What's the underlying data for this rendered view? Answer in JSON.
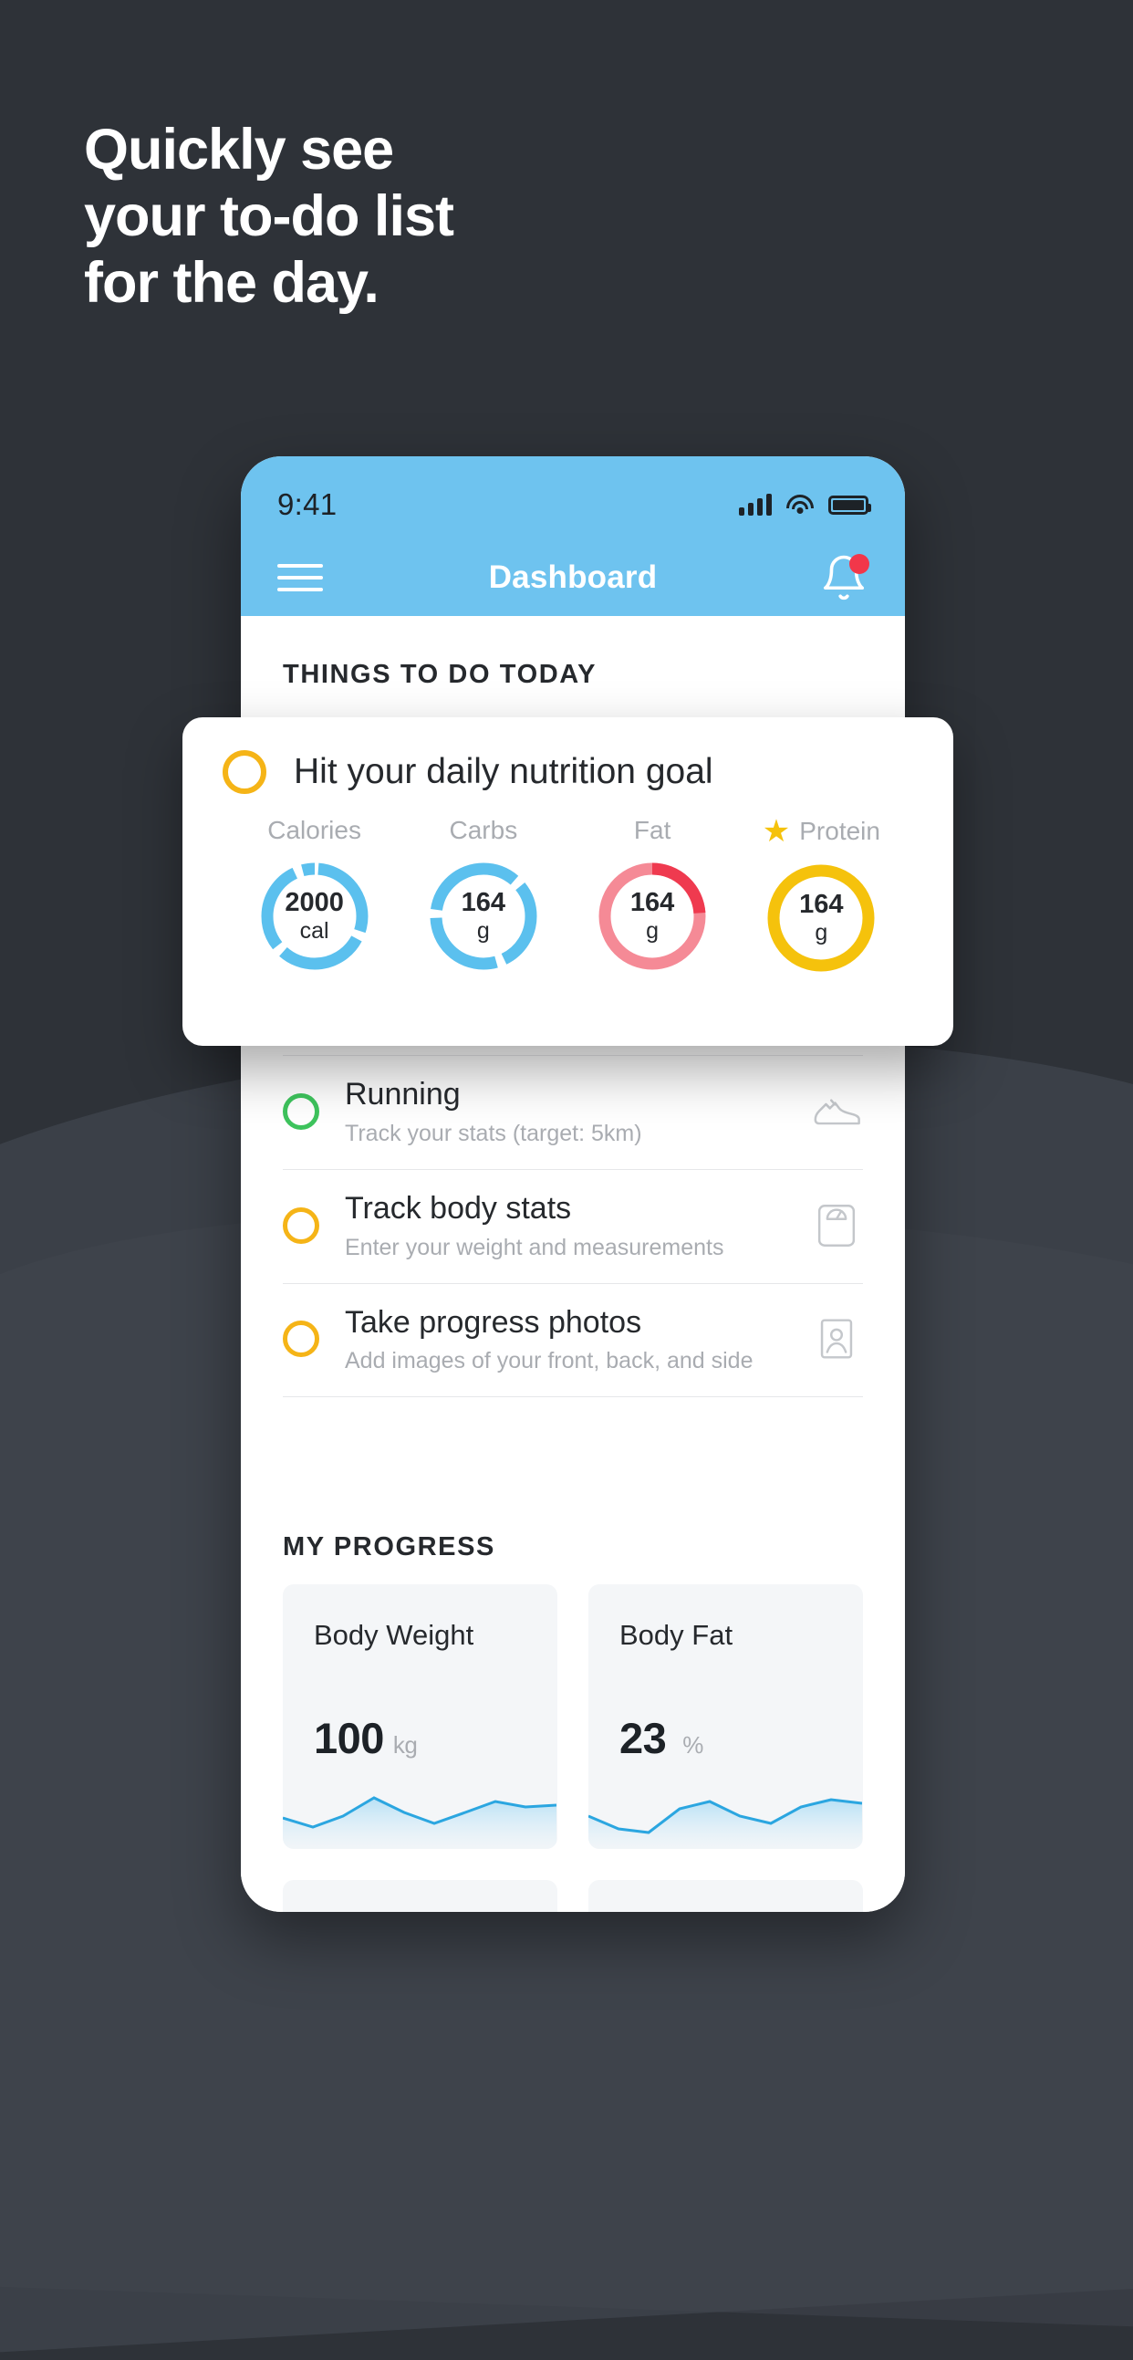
{
  "headline": "Quickly see\nyour to-do list\nfor the day.",
  "colors": {
    "background": "#2e3238",
    "header_blue": "#6ec3ef",
    "accent_yellow": "#f5b417",
    "accent_green": "#3ec45d",
    "accent_red": "#f2374a",
    "ring_blue": "#5bc0ee",
    "ring_pink": "#f58a96",
    "ring_red": "#ef3a4f",
    "ring_yellow": "#f5c20c",
    "spark_blue": "#2ba6e0"
  },
  "status_bar": {
    "time": "9:41",
    "icons": [
      "signal-icon",
      "wifi-icon",
      "battery-icon"
    ]
  },
  "nav": {
    "menu_icon": "hamburger-icon",
    "title": "Dashboard",
    "bell_icon": "bell-icon",
    "has_notification": true
  },
  "sections": {
    "todo_heading": "THINGS TO DO TODAY",
    "progress_heading": "MY PROGRESS"
  },
  "nutrition_card": {
    "checkbox_state": "incomplete",
    "title": "Hit your daily nutrition goal",
    "macros": [
      {
        "label": "Calories",
        "value": "2000",
        "unit": "cal",
        "ring_style": "segmented",
        "color": "#5bc0ee",
        "starred": false
      },
      {
        "label": "Carbs",
        "value": "164",
        "unit": "g",
        "ring_style": "segmented",
        "color": "#5bc0ee",
        "starred": false
      },
      {
        "label": "Fat",
        "value": "164",
        "unit": "g",
        "ring_style": "two-tone",
        "color": "#f58a96",
        "accent": "#ef3a4f",
        "starred": false
      },
      {
        "label": "Protein",
        "value": "164",
        "unit": "g",
        "ring_style": "solid",
        "color": "#f5c20c",
        "starred": true
      }
    ]
  },
  "todo_items": [
    {
      "title": "Running",
      "subtitle": "Track your stats (target: 5km)",
      "circle_color": "#3ec45d",
      "icon": "running-shoe-icon"
    },
    {
      "title": "Track body stats",
      "subtitle": "Enter your weight and measurements",
      "circle_color": "#f5b417",
      "icon": "weight-scale-icon"
    },
    {
      "title": "Take progress photos",
      "subtitle": "Add images of your front, back, and side",
      "circle_color": "#f5b417",
      "icon": "photo-person-icon"
    }
  ],
  "progress_cards": [
    {
      "title": "Body Weight",
      "value": "100",
      "unit": "kg",
      "sparkline": [
        34,
        44,
        56,
        40,
        26,
        34,
        42,
        30,
        20,
        24
      ]
    },
    {
      "title": "Body Fat",
      "value": "23",
      "unit": "%",
      "sparkline": [
        34,
        50,
        58,
        40,
        30,
        38,
        46,
        32,
        22,
        26
      ]
    }
  ],
  "chart_data": [
    {
      "type": "area",
      "title": "Body Weight",
      "x": [
        1,
        2,
        3,
        4,
        5,
        6,
        7,
        8,
        9,
        10
      ],
      "values": [
        34,
        44,
        56,
        40,
        26,
        34,
        42,
        30,
        20,
        24
      ],
      "xlabel": "",
      "ylabel": "kg",
      "grid": false,
      "legend": "none"
    },
    {
      "type": "area",
      "title": "Body Fat",
      "x": [
        1,
        2,
        3,
        4,
        5,
        6,
        7,
        8,
        9,
        10
      ],
      "values": [
        34,
        50,
        58,
        40,
        30,
        38,
        46,
        32,
        22,
        26
      ],
      "xlabel": "",
      "ylabel": "%",
      "grid": false,
      "legend": "none"
    }
  ]
}
